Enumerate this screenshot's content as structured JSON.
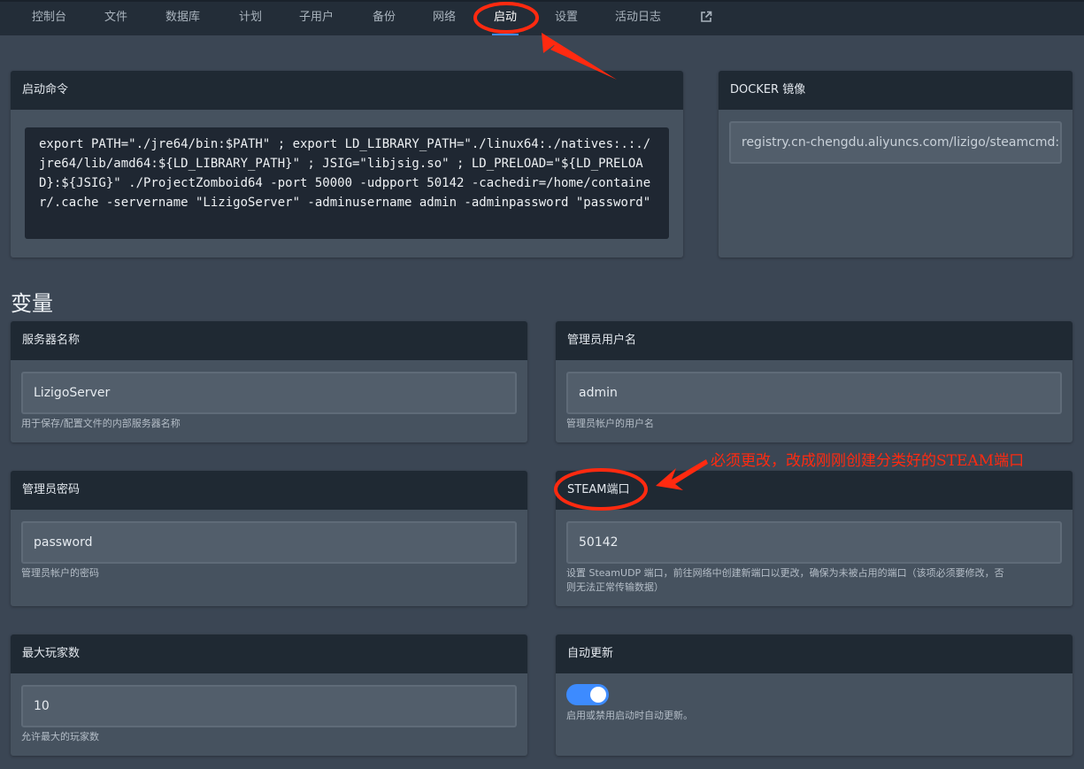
{
  "nav": {
    "tabs": [
      "控制台",
      "文件",
      "数据库",
      "计划",
      "子用户",
      "备份",
      "网络",
      "启动",
      "设置",
      "活动日志"
    ],
    "active": "启动",
    "external_icon": "external-link-icon"
  },
  "startup_command": {
    "title": "启动命令",
    "command": "export PATH=\"./jre64/bin:$PATH\" ; export LD_LIBRARY_PATH=\"./linux64:./natives:.:./jre64/lib/amd64:${LD_LIBRARY_PATH}\" ; JSIG=\"libjsig.so\" ; LD_PRELOAD=\"${LD_PRELOAD}:${JSIG}\" ./ProjectZomboid64 -port 50000 -udpport 50142 -cachedir=/home/container/.cache -servername \"LizigoServer\" -adminusername admin -adminpassword \"password\""
  },
  "docker": {
    "title": "DOCKER 镜像",
    "image": "registry.cn-chengdu.aliyuncs.com/lizigo/steamcmd:o"
  },
  "variables": {
    "title": "变量",
    "server_name": {
      "label": "服务器名称",
      "value": "LizigoServer",
      "hint": "用于保存/配置文件的内部服务器名称"
    },
    "admin_user": {
      "label": "管理员用户名",
      "value": "admin",
      "hint": "管理员帐户的用户名"
    },
    "admin_password": {
      "label": "管理员密码",
      "value": "password",
      "hint": "管理员帐户的密码"
    },
    "steam_port": {
      "label": "STEAM端口",
      "value": "50142",
      "hint_line1": "设置 SteamUDP 端口，前往网络中创建新端口以更改，确保为未被占用的端口（该项必须要修改，否",
      "hint_line2": "则无法正常传输数据）"
    },
    "max_players": {
      "label": "最大玩家数",
      "value": "10",
      "hint": "允许最大的玩家数"
    },
    "auto_update": {
      "label": "自动更新",
      "enabled": true,
      "hint": "启用或禁用启动时自动更新。"
    }
  },
  "annotation": {
    "text": "必须更改，改成刚刚创建分类好的STEAM端口",
    "color": "#ff2a10"
  }
}
